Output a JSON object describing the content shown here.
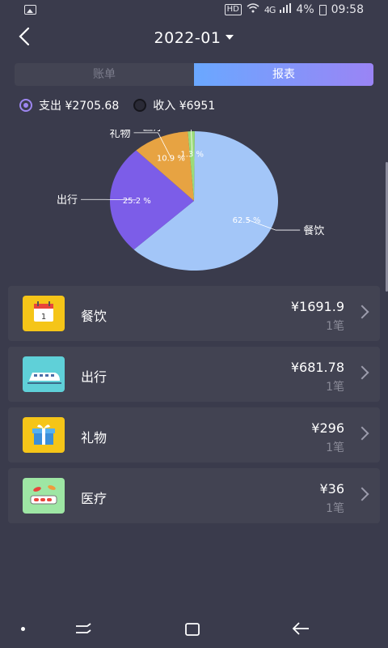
{
  "status": {
    "hd": "HD",
    "signal": "4G",
    "battery": "4%",
    "time": "09:58"
  },
  "header": {
    "month": "2022-01"
  },
  "tabs": [
    {
      "label": "账单",
      "active": false
    },
    {
      "label": "报表",
      "active": true
    }
  ],
  "summary": {
    "expense_label": "支出 ¥2705.68",
    "income_label": "收入 ¥6951",
    "selected": "expense"
  },
  "chart_data": {
    "type": "pie",
    "slices": [
      {
        "label": "餐饮",
        "percent": 62.5,
        "percent_label": "62.5 %",
        "color": "#a3c6f8"
      },
      {
        "label": "出行",
        "percent": 25.2,
        "percent_label": "25.2 %",
        "color": "#7c5de8"
      },
      {
        "label": "礼物",
        "percent": 10.9,
        "percent_label": "10.9 %",
        "color": "#e7a342"
      },
      {
        "label": "医疗",
        "percent": 1.3,
        "percent_label": "1.3 %",
        "color": "#9bdb7a"
      }
    ]
  },
  "categories": [
    {
      "name": "餐饮",
      "amount": "¥1691.9",
      "count": "1笔",
      "icon": "calendar-icon",
      "color": "#f5c518"
    },
    {
      "name": "出行",
      "amount": "¥681.78",
      "count": "1笔",
      "icon": "train-icon",
      "color": "#5fd0d8"
    },
    {
      "name": "礼物",
      "amount": "¥296",
      "count": "1笔",
      "icon": "gift-icon",
      "color": "#f5c518"
    },
    {
      "name": "医疗",
      "amount": "¥36",
      "count": "1笔",
      "icon": "medicine-icon",
      "color": "#9ee6a4"
    }
  ]
}
